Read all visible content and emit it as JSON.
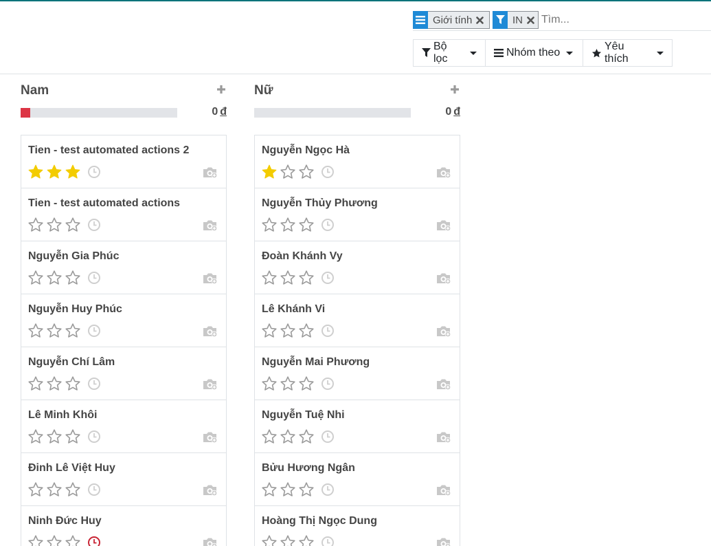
{
  "search": {
    "facets": [
      {
        "label": "Giới tính",
        "icon": "group-by-icon"
      },
      {
        "label": "IN",
        "icon": "filter-icon"
      }
    ],
    "placeholder": "Tìm..."
  },
  "toolbar": {
    "filters_label": "Bộ lọc",
    "groupby_label": "Nhóm theo",
    "favorites_label": "Yêu thích"
  },
  "colors": {
    "accent": "#1f8ad6",
    "star_filled": "#f3cc00",
    "activity_overdue": "#c82333",
    "progress_danger": "#dc3545"
  },
  "columns": [
    {
      "title": "Nam",
      "total_value": "0",
      "currency": "đ",
      "progress_fraction": 0.06,
      "cards": [
        {
          "name": "Tien - test automated actions 2",
          "stars": 3,
          "activity": "none"
        },
        {
          "name": "Tien - test automated actions",
          "stars": 0,
          "activity": "none"
        },
        {
          "name": "Nguyễn Gia Phúc",
          "stars": 0,
          "activity": "none"
        },
        {
          "name": "Nguyễn Huy Phúc",
          "stars": 0,
          "activity": "none"
        },
        {
          "name": "Nguyễn Chí Lâm",
          "stars": 0,
          "activity": "none"
        },
        {
          "name": "Lê Minh Khôi",
          "stars": 0,
          "activity": "none"
        },
        {
          "name": "Đinh Lê Việt Huy",
          "stars": 0,
          "activity": "none"
        },
        {
          "name": "Ninh Đức Huy",
          "stars": 0,
          "activity": "overdue"
        }
      ]
    },
    {
      "title": "Nữ",
      "total_value": "0",
      "currency": "đ",
      "progress_fraction": 0,
      "cards": [
        {
          "name": "Nguyễn Ngọc Hà",
          "stars": 1,
          "activity": "none"
        },
        {
          "name": "Nguyễn Thủy Phương",
          "stars": 0,
          "activity": "none"
        },
        {
          "name": "Đoàn Khánh Vy",
          "stars": 0,
          "activity": "none"
        },
        {
          "name": "Lê Khánh Vi",
          "stars": 0,
          "activity": "none"
        },
        {
          "name": "Nguyễn Mai Phương",
          "stars": 0,
          "activity": "none"
        },
        {
          "name": "Nguyễn Tuệ Nhi",
          "stars": 0,
          "activity": "none"
        },
        {
          "name": "Bửu Hương Ngân",
          "stars": 0,
          "activity": "none"
        },
        {
          "name": "Hoàng Thị Ngọc Dung",
          "stars": 0,
          "activity": "none"
        }
      ]
    }
  ]
}
